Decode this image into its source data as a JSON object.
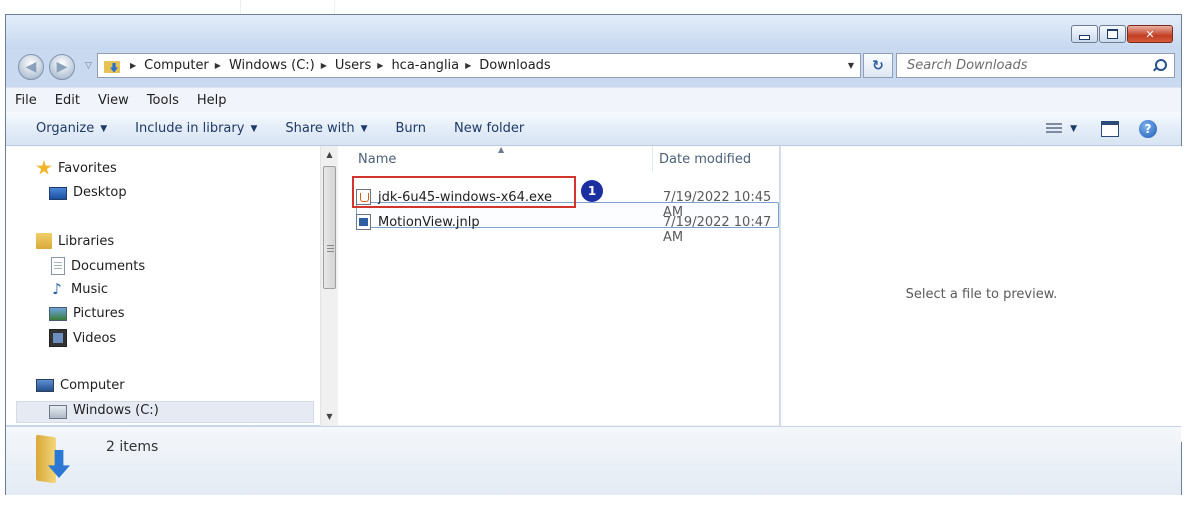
{
  "address": {
    "segments": [
      "Computer",
      "Windows (C:)",
      "Users",
      "hca-anglia",
      "Downloads"
    ]
  },
  "search": {
    "placeholder": "Search Downloads"
  },
  "menu": [
    "File",
    "Edit",
    "View",
    "Tools",
    "Help"
  ],
  "toolbar": {
    "organize": "Organize",
    "include_in_library": "Include in library",
    "share_with": "Share with",
    "burn": "Burn",
    "new_folder": "New folder"
  },
  "nav": {
    "favorites": "Favorites",
    "desktop": "Desktop",
    "libraries": "Libraries",
    "documents": "Documents",
    "music": "Music",
    "pictures": "Pictures",
    "videos": "Videos",
    "computer": "Computer",
    "windows_drive": "Windows (C:)"
  },
  "columns": {
    "name": "Name",
    "date_modified": "Date modified"
  },
  "files": [
    {
      "name": "jdk-6u45-windows-x64.exe",
      "date": "7/19/2022 10:45 AM",
      "icon": "java-installer-icon"
    },
    {
      "name": "MotionView.jnlp",
      "date": "7/19/2022 10:47 AM",
      "icon": "jnlp-file-icon"
    }
  ],
  "annotation": {
    "badge": "1",
    "color": "#d2352b",
    "badge_color": "#1c2fa0"
  },
  "preview": {
    "text": "Select a file to preview."
  },
  "details": {
    "count": "2 items"
  }
}
